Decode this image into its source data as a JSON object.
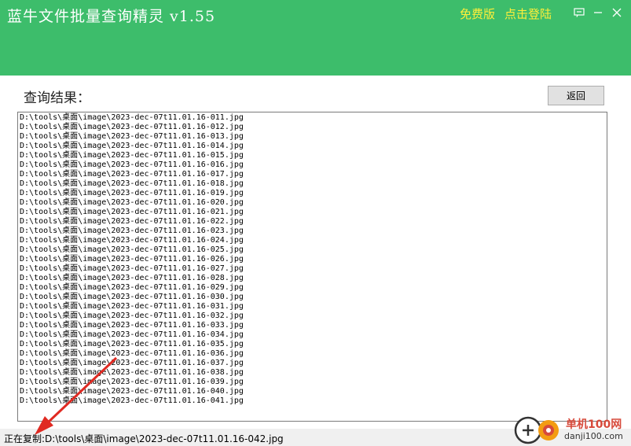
{
  "window": {
    "title": "蓝牛文件批量查询精灵 v1.55",
    "free_version": "免费版",
    "login": "点击登陆",
    "icons": [
      "message-icon",
      "minimize-icon",
      "close-icon"
    ]
  },
  "main": {
    "results_label": "查询结果：",
    "back_button": "返回",
    "results": [
      "D:\\tools\\桌面\\image\\2023-dec-07t11.01.16-011.jpg",
      "D:\\tools\\桌面\\image\\2023-dec-07t11.01.16-012.jpg",
      "D:\\tools\\桌面\\image\\2023-dec-07t11.01.16-013.jpg",
      "D:\\tools\\桌面\\image\\2023-dec-07t11.01.16-014.jpg",
      "D:\\tools\\桌面\\image\\2023-dec-07t11.01.16-015.jpg",
      "D:\\tools\\桌面\\image\\2023-dec-07t11.01.16-016.jpg",
      "D:\\tools\\桌面\\image\\2023-dec-07t11.01.16-017.jpg",
      "D:\\tools\\桌面\\image\\2023-dec-07t11.01.16-018.jpg",
      "D:\\tools\\桌面\\image\\2023-dec-07t11.01.16-019.jpg",
      "D:\\tools\\桌面\\image\\2023-dec-07t11.01.16-020.jpg",
      "D:\\tools\\桌面\\image\\2023-dec-07t11.01.16-021.jpg",
      "D:\\tools\\桌面\\image\\2023-dec-07t11.01.16-022.jpg",
      "D:\\tools\\桌面\\image\\2023-dec-07t11.01.16-023.jpg",
      "D:\\tools\\桌面\\image\\2023-dec-07t11.01.16-024.jpg",
      "D:\\tools\\桌面\\image\\2023-dec-07t11.01.16-025.jpg",
      "D:\\tools\\桌面\\image\\2023-dec-07t11.01.16-026.jpg",
      "D:\\tools\\桌面\\image\\2023-dec-07t11.01.16-027.jpg",
      "D:\\tools\\桌面\\image\\2023-dec-07t11.01.16-028.jpg",
      "D:\\tools\\桌面\\image\\2023-dec-07t11.01.16-029.jpg",
      "D:\\tools\\桌面\\image\\2023-dec-07t11.01.16-030.jpg",
      "D:\\tools\\桌面\\image\\2023-dec-07t11.01.16-031.jpg",
      "D:\\tools\\桌面\\image\\2023-dec-07t11.01.16-032.jpg",
      "D:\\tools\\桌面\\image\\2023-dec-07t11.01.16-033.jpg",
      "D:\\tools\\桌面\\image\\2023-dec-07t11.01.16-034.jpg",
      "D:\\tools\\桌面\\image\\2023-dec-07t11.01.16-035.jpg",
      "D:\\tools\\桌面\\image\\2023-dec-07t11.01.16-036.jpg",
      "D:\\tools\\桌面\\image\\2023-dec-07t11.01.16-037.jpg",
      "D:\\tools\\桌面\\image\\2023-dec-07t11.01.16-038.jpg",
      "D:\\tools\\桌面\\image\\2023-dec-07t11.01.16-039.jpg",
      "D:\\tools\\桌面\\image\\2023-dec-07t11.01.16-040.jpg",
      "D:\\tools\\桌面\\image\\2023-dec-07t11.01.16-041.jpg"
    ]
  },
  "status": {
    "text": "正在复制:D:\\tools\\桌面\\image\\2023-dec-07t11.01.16-042.jpg"
  },
  "watermark": {
    "name": "单机100网",
    "domain": "danji100.com"
  },
  "colors": {
    "header_bg": "#3dbd6b",
    "header_link": "#ffef3a",
    "arrow": "#e02a22"
  }
}
